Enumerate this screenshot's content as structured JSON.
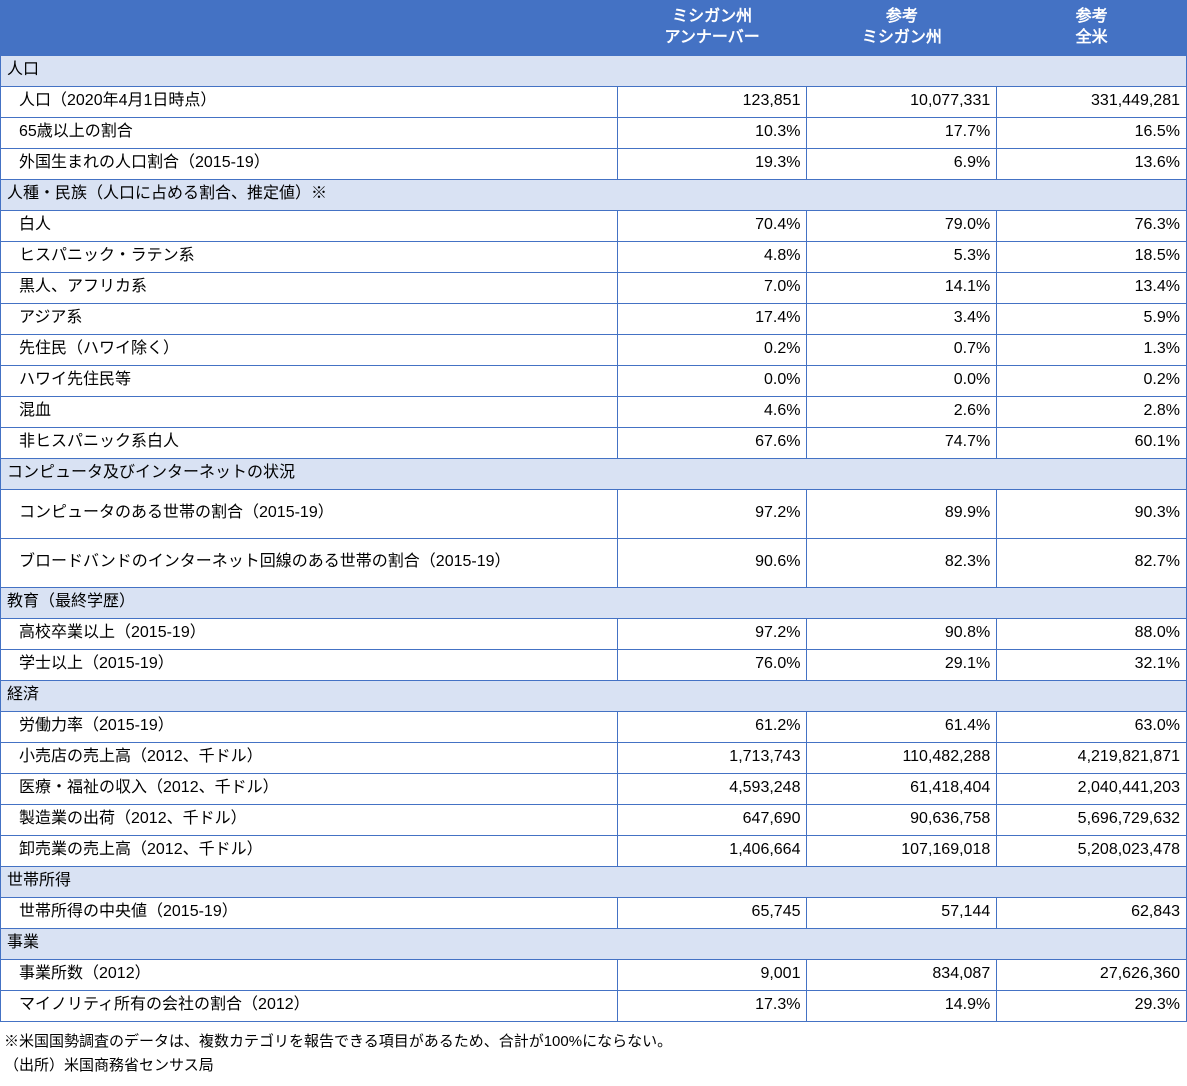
{
  "header": {
    "blank": "",
    "col1_line1": "ミシガン州",
    "col1_line2": "アンナーバー",
    "col2_line1": "参考",
    "col2_line2": "ミシガン州",
    "col3_line1": "参考",
    "col3_line2": "全米"
  },
  "sections": [
    {
      "title": "人口",
      "rows": [
        {
          "label": "人口（2020年4月1日時点）",
          "v1": "123,851",
          "v2": "10,077,331",
          "v3": "331,449,281"
        },
        {
          "label": "65歳以上の割合",
          "v1": "10.3%",
          "v2": "17.7%",
          "v3": "16.5%"
        },
        {
          "label": "外国生まれの人口割合（2015-19）",
          "v1": "19.3%",
          "v2": "6.9%",
          "v3": "13.6%"
        }
      ]
    },
    {
      "title": "人種・民族（人口に占める割合、推定値）※",
      "rows": [
        {
          "label": "白人",
          "v1": "70.4%",
          "v2": "79.0%",
          "v3": "76.3%"
        },
        {
          "label": "ヒスパニック・ラテン系",
          "v1": "4.8%",
          "v2": "5.3%",
          "v3": "18.5%"
        },
        {
          "label": "黒人、アフリカ系",
          "v1": "7.0%",
          "v2": "14.1%",
          "v3": "13.4%"
        },
        {
          "label": "アジア系",
          "v1": "17.4%",
          "v2": "3.4%",
          "v3": "5.9%"
        },
        {
          "label": "先住民（ハワイ除く）",
          "v1": "0.2%",
          "v2": "0.7%",
          "v3": "1.3%"
        },
        {
          "label": "ハワイ先住民等",
          "v1": "0.0%",
          "v2": "0.0%",
          "v3": "0.2%"
        },
        {
          "label": "混血",
          "v1": "4.6%",
          "v2": "2.6%",
          "v3": "2.8%"
        },
        {
          "label": "非ヒスパニック系白人",
          "v1": "67.6%",
          "v2": "74.7%",
          "v3": "60.1%"
        }
      ]
    },
    {
      "title": "コンピュータ及びインターネットの状況",
      "rows": [
        {
          "label": "コンピュータのある世帯の割合（2015-19）",
          "v1": "97.2%",
          "v2": "89.9%",
          "v3": "90.3%",
          "tall": true
        },
        {
          "label": "ブロードバンドのインターネット回線のある世帯の割合（2015-19）",
          "v1": "90.6%",
          "v2": "82.3%",
          "v3": "82.7%",
          "tall": true
        }
      ]
    },
    {
      "title": "教育（最終学歴）",
      "rows": [
        {
          "label": "高校卒業以上（2015-19）",
          "v1": "97.2%",
          "v2": "90.8%",
          "v3": "88.0%"
        },
        {
          "label": "学士以上（2015-19）",
          "v1": "76.0%",
          "v2": "29.1%",
          "v3": "32.1%"
        }
      ]
    },
    {
      "title": "経済",
      "rows": [
        {
          "label": "労働力率（2015-19）",
          "v1": "61.2%",
          "v2": "61.4%",
          "v3": "63.0%"
        },
        {
          "label": "小売店の売上高（2012、千ドル）",
          "v1": "1,713,743",
          "v2": "110,482,288",
          "v3": "4,219,821,871"
        },
        {
          "label": "医療・福祉の収入（2012、千ドル）",
          "v1": "4,593,248",
          "v2": "61,418,404",
          "v3": "2,040,441,203"
        },
        {
          "label": "製造業の出荷（2012、千ドル）",
          "v1": "647,690",
          "v2": "90,636,758",
          "v3": "5,696,729,632"
        },
        {
          "label": "卸売業の売上高（2012、千ドル）",
          "v1": "1,406,664",
          "v2": "107,169,018",
          "v3": "5,208,023,478"
        }
      ]
    },
    {
      "title": "世帯所得",
      "rows": [
        {
          "label": "世帯所得の中央値（2015-19）",
          "v1": "65,745",
          "v2": "57,144",
          "v3": "62,843"
        }
      ]
    },
    {
      "title": "事業",
      "rows": [
        {
          "label": "事業所数（2012）",
          "v1": "9,001",
          "v2": "834,087",
          "v3": "27,626,360"
        },
        {
          "label": "マイノリティ所有の会社の割合（2012）",
          "v1": "17.3%",
          "v2": "14.9%",
          "v3": "29.3%"
        }
      ]
    }
  ],
  "notes": {
    "line1": "※米国国勢調査のデータは、複数カテゴリを報告できる項目があるため、合計が100%にならない。",
    "line2": "（出所）米国商務省センサス局"
  }
}
